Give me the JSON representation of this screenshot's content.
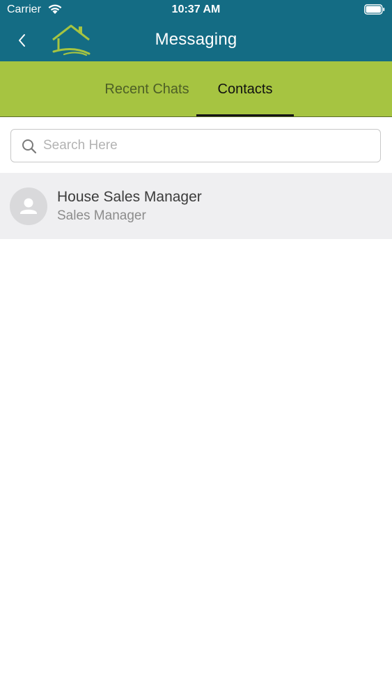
{
  "status_bar": {
    "carrier": "Carrier",
    "time": "10:37 AM"
  },
  "nav": {
    "title": "Messaging",
    "back_icon": "chevron-left-icon",
    "logo_icon": "house-logo-icon"
  },
  "tabs": [
    {
      "label": "Recent Chats",
      "selected": false
    },
    {
      "label": "Contacts",
      "selected": true
    }
  ],
  "search": {
    "placeholder": "Search Here",
    "value": "",
    "icon": "search-icon"
  },
  "contacts": [
    {
      "name": "House Sales Manager",
      "role": "Sales Manager",
      "avatar_icon": "person-icon"
    }
  ],
  "colors": {
    "header": "#146c84",
    "tab_bar": "#a6c441",
    "selected_row": "#efeff1",
    "logo": "#a6c441"
  }
}
